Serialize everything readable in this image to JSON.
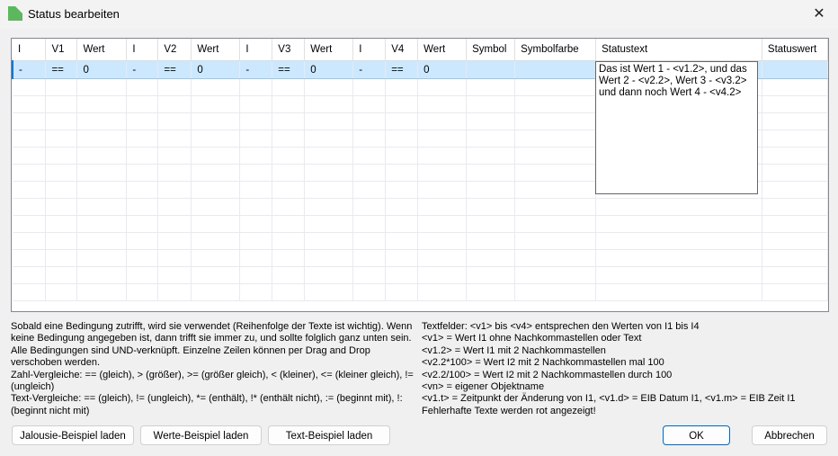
{
  "window": {
    "title": "Status bearbeiten",
    "close_glyph": "✕"
  },
  "table": {
    "columns": [
      "I",
      "V1",
      "Wert",
      "I",
      "V2",
      "Wert",
      "I",
      "V3",
      "Wert",
      "I",
      "V4",
      "Wert",
      "Symbol",
      "Symbolfarbe",
      "Statustext",
      "Statuswert"
    ],
    "rows": [
      [
        "-",
        "==",
        "0",
        "-",
        "==",
        "0",
        "-",
        "==",
        "0",
        "-",
        "==",
        "0",
        "",
        "",
        "",
        ""
      ]
    ],
    "empty_rows": 13,
    "editor_value": "Das ist Wert 1 - <v1.2>, und das\nWert 2 - <v2.2>, Wert 3 - <v3.2>\nund dann noch Wert 4 - <v4.2>"
  },
  "help_left": [
    "Sobald eine Bedingung zutrifft, wird sie verwendet (Reihenfolge der Texte ist wichtig). Wenn keine Bedingung angegeben ist, dann trifft sie immer zu, und sollte folglich ganz unten sein. Alle Bedingungen sind UND-verknüpft. Einzelne Zeilen können per Drag and Drop verschoben werden.",
    "Zahl-Vergleiche: == (gleich), > (größer), >= (größer gleich), < (kleiner), <= (kleiner gleich), != (ungleich)",
    "Text-Vergleiche: == (gleich), != (ungleich), *= (enthält), !* (enthält nicht), := (beginnt mit), !: (beginnt nicht mit)"
  ],
  "help_right": [
    "Textfelder: <v1> bis <v4> entsprechen den Werten von I1 bis I4",
    "<v1> = Wert I1 ohne Nachkommastellen oder Text",
    "<v1.2> = Wert I1 mit 2 Nachkommastellen",
    "<v2.2*100> = Wert I2 mit 2 Nachkommastellen mal 100",
    "<v2.2/100> = Wert I2 mit 2 Nachkommastellen durch 100",
    "<vn> = eigener Objektname",
    "<v1.t> = Zeitpunkt der Änderung von I1, <v1.d> = EIB Datum I1, <v1.m> = EIB Zeit I1",
    "Fehlerhafte Texte werden rot angezeigt!"
  ],
  "buttons": {
    "jalousie": "Jalousie-Beispiel laden",
    "werte": "Werte-Beispiel laden",
    "text": "Text-Beispiel laden",
    "ok": "OK",
    "cancel": "Abbrechen"
  }
}
